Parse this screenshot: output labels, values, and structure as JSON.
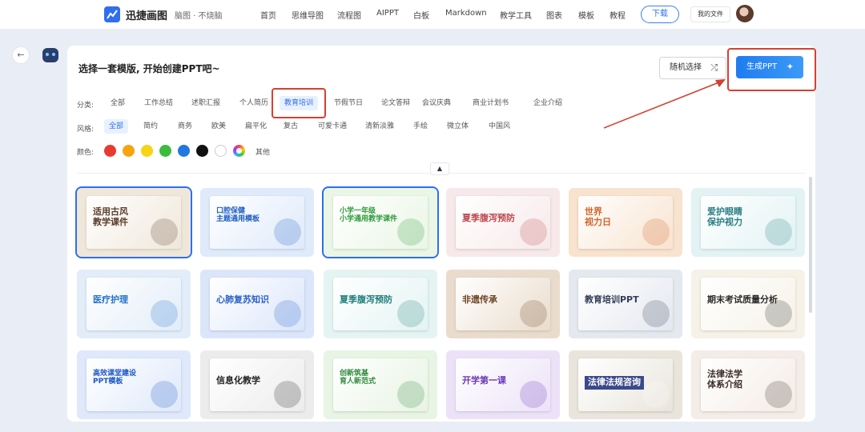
{
  "app": {
    "brand": "迅捷画图",
    "subtitle": "脑图 · 不烧脑"
  },
  "nav": {
    "items": [
      "首页",
      "思维导图",
      "流程图",
      "AIPPT",
      "白板",
      "Markdown",
      "教学工具",
      "图表",
      "模板",
      "教程"
    ],
    "download": "下载",
    "my_files": "我的文件"
  },
  "main": {
    "title": "选择一套模版, 开始创建PPT吧~",
    "random_button": "随机选择",
    "generate_button": "生成PPT"
  },
  "filters": {
    "category": {
      "label": "分类:",
      "options": [
        "全部",
        "工作总结",
        "述职汇报",
        "个人简历",
        "教育培训",
        "节假节日",
        "论文答辩",
        "会议庆典",
        "商业计划书",
        "企业介绍"
      ],
      "selected": "教育培训"
    },
    "style": {
      "label": "风格:",
      "options": [
        "全部",
        "简约",
        "商务",
        "欧美",
        "扁平化",
        "复古",
        "可爱卡通",
        "清新淡雅",
        "手绘",
        "微立体",
        "中国风"
      ],
      "selected": "全部"
    },
    "color": {
      "label": "颜色:",
      "swatches": [
        "#e83a2f",
        "#f5a40f",
        "#f7d414",
        "#3cbb3c",
        "#2278e0",
        "#111111",
        "#ffffff",
        "multi"
      ],
      "other_label": "其他"
    }
  },
  "templates": [
    {
      "title": "适用古风\n教学课件",
      "bg": "#efe7da",
      "color": "#5a3d2b",
      "selected": true
    },
    {
      "title": "口腔保健\n主题通用模板",
      "bg": "#dfeafb",
      "color": "#1f5fc4",
      "selected": false
    },
    {
      "title": "小学一年级\n小学通用教学课件",
      "bg": "#eaf6e6",
      "color": "#2f9a3a",
      "selected": true
    },
    {
      "title": "夏季腹泻预防",
      "bg": "#f7e9ea",
      "color": "#c0474f",
      "selected": false
    },
    {
      "title": "世界\n视力日",
      "bg": "#f8e3cf",
      "color": "#d1642a",
      "selected": false
    },
    {
      "title": "爱护眼睛\n保护视力",
      "bg": "#e3f3f4",
      "color": "#2a7f86",
      "selected": false
    },
    {
      "title": "医疗护理",
      "bg": "#e2edf9",
      "color": "#2573c9",
      "selected": false
    },
    {
      "title": "心肺复苏知识",
      "bg": "#dbe6fb",
      "color": "#2b60c8",
      "selected": false
    },
    {
      "title": "夏季腹泻预防",
      "bg": "#e4f4f3",
      "color": "#1f7f7a",
      "selected": false
    },
    {
      "title": "非遗传承",
      "bg": "#eadccc",
      "color": "#6b4526",
      "selected": false
    },
    {
      "title": "教育培训PPT",
      "bg": "#e4e8ef",
      "color": "#333e55",
      "selected": false
    },
    {
      "title": "期末考试质量分析",
      "bg": "#f6f2e8",
      "color": "#2b2b2b",
      "selected": false
    },
    {
      "title": "高效课堂建设\nPPT模板",
      "bg": "#dfe9fb",
      "color": "#1b55c4",
      "selected": false
    },
    {
      "title": "信息化教学",
      "bg": "#ececec",
      "color": "#222222",
      "selected": false
    },
    {
      "title": "创新筑基\n育人新范式",
      "bg": "#e8f4e4",
      "color": "#2e8a3c",
      "selected": false
    },
    {
      "title": "开学第一课",
      "bg": "#ece2f8",
      "color": "#6a38b8",
      "selected": false
    },
    {
      "title": "法律法规咨询",
      "bg": "#e9e5dc",
      "color": "#ffffff",
      "selected": false
    },
    {
      "title": "法律法学\n体系介绍",
      "bg": "#f4ece6",
      "color": "#3a2b26",
      "selected": false
    }
  ]
}
